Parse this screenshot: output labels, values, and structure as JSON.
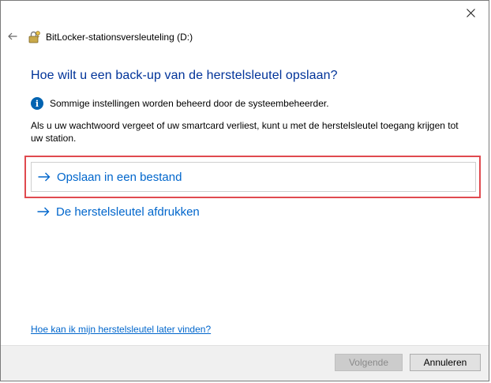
{
  "window": {
    "title": "BitLocker-stationsversleuteling (D:)",
    "icons": {
      "close": "close-icon",
      "back": "back-arrow-icon",
      "app": "bitlocker-key-icon"
    }
  },
  "main": {
    "heading": "Hoe wilt u een back-up van de herstelsleutel opslaan?",
    "info_text": "Sommige instellingen worden beheerd door de systeembeheerder.",
    "description": "Als u uw wachtwoord vergeet of uw smartcard verliest, kunt u met de herstelsleutel toegang krijgen tot uw station.",
    "options": [
      {
        "label": "Opslaan in een bestand",
        "highlighted": true
      },
      {
        "label": "De herstelsleutel afdrukken",
        "highlighted": false
      }
    ],
    "help_link": "Hoe kan ik mijn herstelsleutel later vinden?"
  },
  "footer": {
    "next_label": "Volgende",
    "next_enabled": false,
    "cancel_label": "Annuleren"
  },
  "colors": {
    "heading": "#003399",
    "link": "#0066cc",
    "highlight_border": "#e04a4f",
    "info_icon": "#0063b1"
  }
}
